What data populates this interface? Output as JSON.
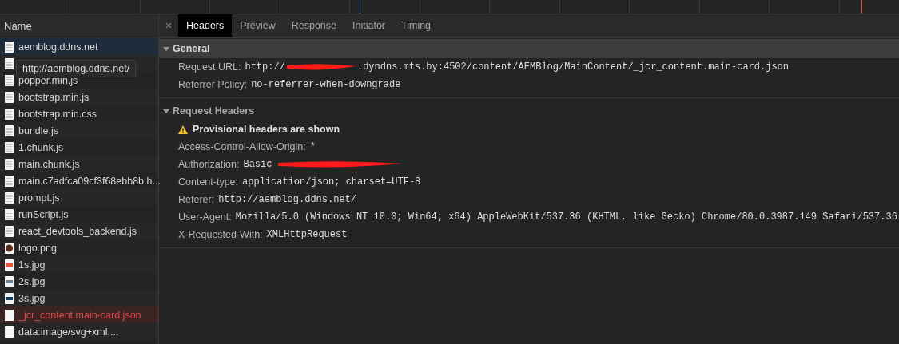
{
  "requests": {
    "column": "Name",
    "tooltip": "http://aemblog.ddns.net/",
    "items": [
      {
        "name": "aemblog.ddns.net",
        "kind": "doc",
        "selected": true,
        "error": false
      },
      {
        "kind": "doc",
        "selected": false,
        "error": false
      },
      {
        "name": "popper.min.js",
        "kind": "doc",
        "selected": false,
        "error": false
      },
      {
        "name": "bootstrap.min.js",
        "kind": "doc",
        "selected": false,
        "error": false
      },
      {
        "name": "bootstrap.min.css",
        "kind": "doc",
        "selected": false,
        "error": false
      },
      {
        "name": "bundle.js",
        "kind": "doc",
        "selected": false,
        "error": false
      },
      {
        "name": "1.chunk.js",
        "kind": "doc",
        "selected": false,
        "error": false
      },
      {
        "name": "main.chunk.js",
        "kind": "doc",
        "selected": false,
        "error": false
      },
      {
        "name": "main.c7adfca09cf3f68ebb8b.h...",
        "kind": "doc",
        "selected": false,
        "error": false
      },
      {
        "name": "prompt.js",
        "kind": "doc",
        "selected": false,
        "error": false
      },
      {
        "name": "runScript.js",
        "kind": "doc",
        "selected": false,
        "error": false
      },
      {
        "name": "react_devtools_backend.js",
        "kind": "doc",
        "selected": false,
        "error": false
      },
      {
        "name": "logo.png",
        "kind": "round",
        "color": "#5a2a14",
        "selected": false,
        "error": false
      },
      {
        "name": "1s.jpg",
        "kind": "image",
        "color": "#e0553c",
        "selected": false,
        "error": false
      },
      {
        "name": "2s.jpg",
        "kind": "image",
        "color": "#6f8291",
        "selected": false,
        "error": false
      },
      {
        "name": "3s.jpg",
        "kind": "image",
        "color": "#123c5e",
        "selected": false,
        "error": false
      },
      {
        "name": "_jcr_content.main-card.json",
        "kind": "blank",
        "selected": false,
        "error": true
      },
      {
        "name": "data:image/svg+xml,...",
        "kind": "blank",
        "selected": false,
        "error": false
      }
    ]
  },
  "detail": {
    "close": "×",
    "tabs": [
      {
        "label": "Headers",
        "selected": true
      },
      {
        "label": "Preview",
        "selected": false
      },
      {
        "label": "Response",
        "selected": false
      },
      {
        "label": "Initiator",
        "selected": false
      },
      {
        "label": "Timing",
        "selected": false
      }
    ],
    "sections": [
      {
        "title": "General",
        "expanded": true,
        "focused": true,
        "rows": [
          {
            "kind": "header",
            "key": "Request URL:",
            "value": "http://",
            "redacted": true,
            "value_after": ".dyndns.mts.by:4502/content/AEMBlog/MainContent/_jcr_content.main-card.json"
          },
          {
            "kind": "header",
            "key": "Referrer Policy:",
            "value": "no-referrer-when-downgrade"
          }
        ]
      },
      {
        "title": "Request Headers",
        "expanded": true,
        "focused": false,
        "rows": [
          {
            "kind": "warning",
            "text": "Provisional headers are shown"
          },
          {
            "kind": "header",
            "key": "Access-Control-Allow-Origin:",
            "value": "*"
          },
          {
            "kind": "header",
            "key": "Authorization:",
            "value": "Basic",
            "redacted": true
          },
          {
            "kind": "header",
            "key": "Content-type:",
            "value": "application/json; charset=UTF-8"
          },
          {
            "kind": "header",
            "key": "Referer:",
            "value": "http://aemblog.ddns.net/"
          },
          {
            "kind": "header",
            "key": "User-Agent:",
            "value": "Mozilla/5.0 (Windows NT 10.0; Win64; x64) AppleWebKit/537.36 (KHTML, like Gecko) Chrome/80.0.3987.149 Safari/537.36"
          },
          {
            "kind": "header",
            "key": "X-Requested-With:",
            "value": "XMLHttpRequest"
          }
        ]
      }
    ]
  }
}
